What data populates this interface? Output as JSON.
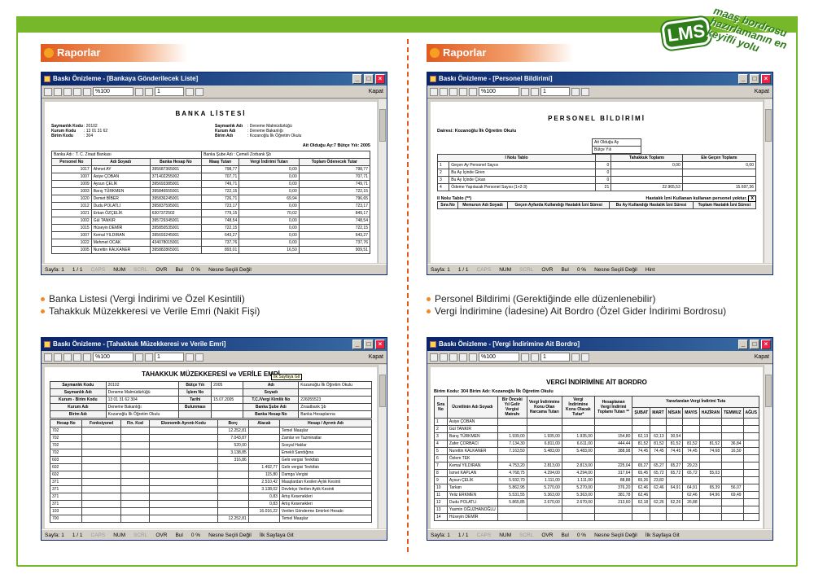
{
  "brand": {
    "logo": "LMS",
    "tagline": "maaş bordrosu hazırlamanın en keyifli yolu",
    "accent": "#76b82a",
    "orange": "#e05a1e"
  },
  "sections": [
    {
      "heading": "Raporlar"
    },
    {
      "heading": "Raporlar"
    }
  ],
  "bullets_left_top": [
    "Banka Listesi (Vergi İndirimi ve Özel Kesintili)",
    "Tahakkuk Müzekkeresi ve Verile Emri (Nakit Fişi)"
  ],
  "bullets_right_top": [
    "Personel Bildirimi (Gerektiğinde elle düzenlenebilir)",
    "Vergi İndirimine (İadesine) Ait Bordro (Özel Gider İndirimi Bordrosu)"
  ],
  "common": {
    "zoom": "%100",
    "page_input": "1",
    "close_label": "Kapat",
    "status_page": "Sayfa: 1",
    "status_of": "1 / 1",
    "status_caps": "CAPS",
    "status_num": "NUM",
    "status_scrl": "SCRL",
    "status_ovr": "OVR",
    "status_bul": "Bul",
    "status_pct": "0 %",
    "status_sel": "Nesne Seçili Değil",
    "status_hint": "Hint",
    "status_first": "İlk Sayfaya Git"
  },
  "win1": {
    "title": "Baskı Önizleme - [Bankaya Gönderilecek Liste]",
    "doc_title": "BANKA LİSTESİ",
    "info": [
      [
        "Saymanlık Kodu",
        ": 20102",
        "Saymanlık Adı",
        ": Deneme Malmüdürlüğü"
      ],
      [
        "Kurum Kodu",
        ": 13 01 31 62",
        "Kurum Adı",
        ": Deneme Bakanlığı"
      ],
      [
        "Birim Kodu",
        ": 304",
        "Birim Adı",
        ": Kozanoğlu İlk Öğretim Okulu"
      ]
    ],
    "period": "Ait Olduğu Ay:7  Bütçe Yılı: 2005",
    "bank": "Banka Adı : T. C. Ziraat Bankası",
    "branch": "Banka Şube Adı : Çemeli Zorbank Şb",
    "headers": [
      "Personel No",
      "Adı Soyadı",
      "Banka Hesap No",
      "Maaş Tutarı",
      "Vergi İndirimi Tutarı",
      "Toplam Ödenecek Tutar"
    ],
    "rows": [
      [
        "1017",
        "Ahmet AY",
        "395687365001",
        "798,77",
        "0,00",
        "798,77"
      ],
      [
        "1007",
        "Asiye ÇOBAN",
        "371402255002",
        "707,71",
        "0,00",
        "707,71"
      ],
      [
        "1009",
        "Aysun ÇELİK",
        "395693385001",
        "749,71",
        "0,00",
        "749,71"
      ],
      [
        "1003",
        "Barış TÜRKMEN",
        "395846555001",
        "722,15",
        "0,00",
        "722,15"
      ],
      [
        "1020",
        "Demet BİBER",
        "395836245001",
        "726,71",
        "69,94",
        "796,65"
      ],
      [
        "1012",
        "Dudu POLATLI",
        "395837595001",
        "723,17",
        "0,00",
        "723,17"
      ],
      [
        "1021",
        "Erkan ÖZÇELİK",
        "6307372502",
        "779,15",
        "70,02",
        "849,17"
      ],
      [
        "1002",
        "Gül TANKIR",
        "395729345001",
        "748,54",
        "0,00",
        "748,54"
      ],
      [
        "1015",
        "Hüseyin DEMİR",
        "395850535001",
        "722,15",
        "0,00",
        "722,15"
      ],
      [
        "1007",
        "Kemal YILDIRAN",
        "395693245001",
        "643,27",
        "0,00",
        "643,27"
      ],
      [
        "1022",
        "Mehmet OCAK",
        "434078015001",
        "737,76",
        "0,00",
        "737,76"
      ],
      [
        "1005",
        "Nurettin KALKANER",
        "395882865001",
        "893,01",
        "16,50",
        "909,51"
      ]
    ]
  },
  "win2": {
    "title": "Baskı Önizleme - [Personel Bildirimi]",
    "doc_title": "PERSONEL BİLDİRİMİ",
    "school": "Dairesi: Kozanoğlu İlk Öğretim Okulu",
    "month_label": "Ait Olduğu Ay",
    "year_label": "Bütçe Yılı",
    "table1_title": "I Nolu Tablo",
    "table1_cols": [
      "Tahakkuk Toplamı",
      "Ele Geçen Toplamı"
    ],
    "table1_rows": [
      [
        "1",
        "Geçen Ay Personel Sayısı",
        "0",
        "0,00",
        "0,00"
      ],
      [
        "2",
        "Bu Ay İçinde Giren",
        "0",
        "",
        ""
      ],
      [
        "3",
        "Bu Ay İçinde Çıkan",
        "0",
        "",
        ""
      ],
      [
        "4",
        "Ödeme Yapılacak Personel Sayısı (1+2-3)",
        "21",
        "22.965,53",
        "15.697,36"
      ]
    ],
    "table2_title": "II Nolu Tablo (**)",
    "table2_note": "Hastalık İzni Kullanan kullanan personel yoktur.",
    "table2_box": "X",
    "table2_cols": [
      "Sıra No",
      "Memurun Adı Soyadı",
      "Geçen Ayfarda Kullandığı Hastalık İzni Süresi",
      "Bu Ay Kullandığı Hastalık İzni Süresi",
      "Toplam Hastalık İzni Süresi"
    ]
  },
  "win3": {
    "title": "Baskı Önizleme - [Tahakkuk Müzekkeresi ve Verile Emri]",
    "doc_title": "TAHAKKUK MÜZEKKERESİ ve VERİLE EMRİ",
    "tooltip": "İlk Sayfaya Git",
    "info": [
      [
        "Saymanlık Kodu",
        "20102",
        "Bütçe Yılı",
        "2005",
        "Adı",
        "Kozanoğlu İlk Öğretim Okulu"
      ],
      [
        "Saymanlık Adı",
        "Deneme Malmüdürlüğü",
        "İşlem No",
        "",
        "Soyadı",
        ""
      ],
      [
        "Kurum - Birim Kodu",
        "13 01 31 62 304",
        "Tarihi",
        "15.07.2005",
        "T.C./Vergi Kimlik No",
        "226055523"
      ],
      [
        "Kurum Adı",
        "Deneme Bakanlığı",
        "Bulunması",
        "",
        "Banka Şube Adı",
        "Ziraatbank Şb"
      ],
      [
        "Birim Adı",
        "Kozanoğlu İlk Öğretim Okulu",
        "",
        "",
        "Banka Hesap No",
        "Banka Hesaplarına"
      ]
    ],
    "col_heads": [
      "Hesap No",
      "Fonksiyonel",
      "Fin. Kod",
      "Ekonomik Ayrıntı Kodu",
      "Borç",
      "Alacak",
      "Hesap / Ayrıntı Adı"
    ],
    "rows": [
      [
        "702",
        "12.252,81",
        "",
        "Temel Maaşlar"
      ],
      [
        "702",
        "7.043,87",
        "",
        "Zamlar ve Tazminatlar"
      ],
      [
        "702",
        "520,00",
        "",
        "Sosyal Haklar"
      ],
      [
        "702",
        "3.138,85",
        "",
        "Emekli Sandığına"
      ],
      [
        "603",
        "316,86",
        "",
        "Gelir vergisi Tevkifatı"
      ],
      [
        "602",
        "",
        "1.492,77",
        "Gelir vergisi Tevkifatı"
      ],
      [
        "602",
        "",
        "115,80",
        "Damga Vergisi"
      ],
      [
        "371",
        "",
        "2.510,42",
        "Maaşlardan Kesilen Aylık Kesinti"
      ],
      [
        "371",
        "",
        "3.138,02",
        "Devletçe Verilen Aylık Kesinti"
      ],
      [
        "371",
        "",
        "0,83",
        "Artış Kesenekleri"
      ],
      [
        "371",
        "",
        "0,83",
        "Artış Kesenekleri"
      ],
      [
        "103",
        "",
        "16.016,22",
        "Verilen Gönderme Emirleri Hesabı"
      ],
      [
        "700",
        "12.252,81",
        "",
        "Temel Maaşlar"
      ]
    ]
  },
  "win4": {
    "title": "Baskı Önizleme - [Vergi İndirimine Ait Bordro]",
    "doc_title": "VERGİ İNDİRİMİNE AİT BORDRO",
    "subtitle": "Birim Kodu: 304 Birim Adı: Kozanoğlu İlk Öğretim Okulu",
    "headers": [
      "Sıra No",
      "Ücretlinin Adı Soyadı",
      "Bir Önceki Yıl Gelir Vergisi Matrahı",
      "Vergi İndirimine Konu Olan Harcama Tutarı",
      "Vergi İndirimine Konu Olacak Tutar*",
      "Hesaplanan Vergi İndirimi Toplamı Tutarı **"
    ],
    "months_head": "Yararlanılan Vergi İndirimi Tuta",
    "months": [
      "ŞUBAT",
      "MART",
      "NİSAN",
      "MAYIS",
      "HAZİRAN",
      "TEMMUZ",
      "AĞUS"
    ],
    "rows": [
      [
        "1",
        "Asiye ÇOBAN",
        "",
        "",
        "",
        "",
        "",
        "",
        "",
        "",
        "",
        "",
        ""
      ],
      [
        "2",
        "Gül TANKIR",
        "",
        "",
        "",
        "",
        "",
        "",
        "",
        "",
        "",
        "",
        ""
      ],
      [
        "3",
        "Barış TÜRKMEN",
        "1.939,00",
        "1.935,00",
        "1.935,00",
        "154,80",
        "62,13",
        "62,13",
        "30,54",
        "",
        "",
        "",
        ""
      ],
      [
        "4",
        "Zafer ÇORBACI",
        "7.134,30",
        "6.811,00",
        "6.611,00",
        "444,44",
        "81,52",
        "81,52",
        "81,52",
        "81,52",
        "81,52",
        "36,84",
        ""
      ],
      [
        "5",
        "Nurettin KALKANER",
        "7.163,50",
        "5.483,00",
        "5.483,00",
        "388,98",
        "74,45",
        "74,45",
        "74,45",
        "74,45",
        "74,68",
        "16,50",
        ""
      ],
      [
        "6",
        "Özlem TEK",
        "",
        "",
        "",
        "",
        "",
        "",
        "",
        "",
        "",
        "",
        ""
      ],
      [
        "7",
        "Kemal YILDIRAN",
        "4.753,20",
        "2.813,00",
        "2.813,00",
        "225,04",
        "65,27",
        "65,27",
        "65,27",
        "29,23",
        "",
        "",
        ""
      ],
      [
        "8",
        "İsmet KAPLAN",
        "4.768,75",
        "4.294,00",
        "4.294,00",
        "317,64",
        "65,45",
        "65,72",
        "65,72",
        "65,72",
        "55,03",
        "",
        ""
      ],
      [
        "9",
        "Aysun ÇELİK",
        "5.932,70",
        "1.111,00",
        "1.111,00",
        "88,88",
        "65,26",
        "23,82",
        "",
        "",
        "",
        "",
        ""
      ],
      [
        "10",
        "Tarkan",
        "5.862,95",
        "5.270,00",
        "5.270,00",
        "376,20",
        "62,46",
        "62,46",
        "64,91",
        "64,91",
        "65,39",
        "56,07",
        ""
      ],
      [
        "11",
        "Yeliz ERKMEN",
        "5.531,55",
        "5.363,00",
        "5.363,00",
        "381,78",
        "62,46",
        "",
        "",
        "62,46",
        "64,96",
        "69,49",
        ""
      ],
      [
        "12",
        "Dudu POLATLI",
        "5.865,85",
        "2.670,00",
        "2.670,00",
        "213,60",
        "62,18",
        "62,26",
        "62,26",
        "26,88",
        "",
        "",
        ""
      ],
      [
        "13",
        "Yasmin OĞUZHANOĞLU",
        "",
        "",
        "",
        "",
        "",
        "",
        "",
        "",
        "",
        "",
        ""
      ],
      [
        "14",
        "Hüseyin DEMİR",
        "",
        "",
        "",
        "",
        "",
        "",
        "",
        "",
        "",
        "",
        ""
      ]
    ]
  }
}
